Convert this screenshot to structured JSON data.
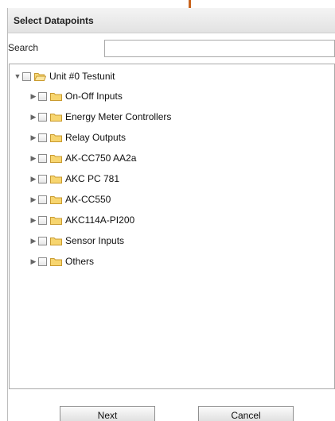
{
  "dialog": {
    "title": "Select Datapoints"
  },
  "search": {
    "label": "Search",
    "value": "",
    "placeholder": ""
  },
  "tree": {
    "root": {
      "label": "Unit #0  Testunit",
      "expanded": true,
      "checked": false
    },
    "children": [
      {
        "label": "On-Off Inputs",
        "expanded": false,
        "checked": false
      },
      {
        "label": "Energy Meter Controllers",
        "expanded": false,
        "checked": false
      },
      {
        "label": "Relay Outputs",
        "expanded": false,
        "checked": false
      },
      {
        "label": "AK-CC750 AA2a",
        "expanded": false,
        "checked": false
      },
      {
        "label": "AKC PC 781",
        "expanded": false,
        "checked": false
      },
      {
        "label": "AK-CC550",
        "expanded": false,
        "checked": false
      },
      {
        "label": "AKC114A-PI200",
        "expanded": false,
        "checked": false
      },
      {
        "label": "Sensor Inputs",
        "expanded": false,
        "checked": false
      },
      {
        "label": "Others",
        "expanded": false,
        "checked": false
      }
    ]
  },
  "buttons": {
    "next_label": "Next",
    "cancel_label": "Cancel"
  },
  "icons": {
    "root_folder": "folder-open-icon",
    "child_folder": "folder-icon",
    "expanded_arrow": "triangle-down-icon",
    "collapsed_arrow": "triangle-right-icon"
  },
  "colors": {
    "marker": "#c8641e",
    "folder": "#f2c94c"
  }
}
